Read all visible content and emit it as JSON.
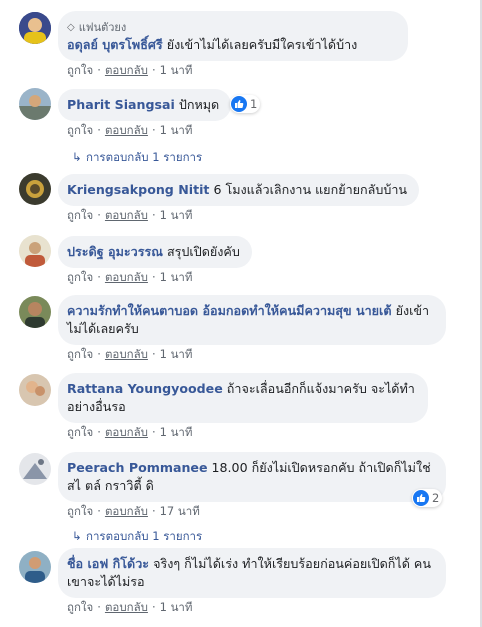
{
  "colors": {
    "name": "#385898",
    "bubble": "#f0f2f5",
    "meta": "#606770",
    "like": "#1877f2"
  },
  "common": {
    "like": "ถูกใจ",
    "reply": "ตอบกลับ",
    "dot": "·"
  },
  "comments": [
    {
      "fan_label": "แฟนตัวยง",
      "name": "อดุลย์ บุตรโพธิ์ศรี",
      "text": "ยังเข้าไม่ได้เลยครับมีใครเข้าได้บ้าง",
      "time": "1 นาที"
    },
    {
      "name": "Pharit Siangsai",
      "text": "ปักหมุด",
      "time": "1 นาที",
      "reactions": "1",
      "replies": "การตอบกลับ 1 รายการ"
    },
    {
      "name": "Kriengsakpong Nitit",
      "text": "6 โมงแล้วเลิกงาน แยกย้ายกลับบ้าน",
      "time": "1 นาที"
    },
    {
      "name": "ประดิฐ อุมะวรรณ",
      "text": "สรุปเปิดยังคับ",
      "time": "1 นาที"
    },
    {
      "name": "ความรักทำให้คนตาบอด อ้อมกอดทำให้คนมีความสุข นายเต้",
      "text": "ยังเข้าไม่ได้เลยครับ",
      "time": "1 นาที"
    },
    {
      "name": "Rattana Youngyoodee",
      "text": "ถ้าจะเลื่อนอีกก็แจ้งมาครับ จะได้ทำอย่างอื่นรอ",
      "time": "1 นาที"
    },
    {
      "name": "Peerach Pommanee",
      "text": "18.00 ก็ยังไม่เปิดหรอกคับ ถ้าเปิดก็ไม่ใช่ สไ ตล์ กราวิตี้ ดิ",
      "time": "17 นาที",
      "reactions": "2",
      "replies": "การตอบกลับ 1 รายการ"
    },
    {
      "name": "ชื่อ เอฟ กิโด้วะ",
      "text": "จริงๆ ก็ไม่ได้เร่ง ทำให้เรียบร้อยก่อนค่อยเปิดก็ได้ คนเขาจะได้ไม่รอ",
      "time": "1 นาที"
    }
  ]
}
